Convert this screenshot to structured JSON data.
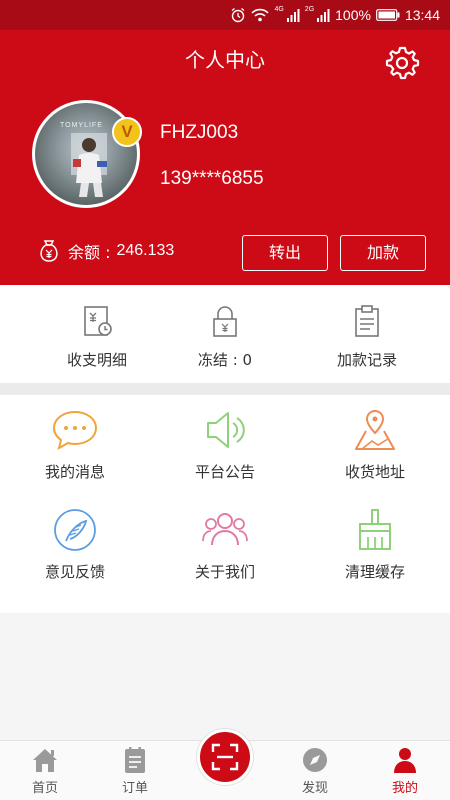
{
  "status_bar": {
    "network_4g": "4G",
    "network_2g": "2G",
    "battery": "100%",
    "time": "13:44"
  },
  "header": {
    "title": "个人中心",
    "avatar_text": "TOMYLIFE",
    "badge": "V",
    "username": "FHZJ003",
    "phone": "139****6855",
    "balance_label": "余额 : ",
    "balance_value": "246.133",
    "transfer_out": "转出",
    "add_funds": "加款"
  },
  "finance": {
    "items": [
      {
        "label": "收支明细",
        "icon": "receipt-clock-icon"
      },
      {
        "label": "冻结 : 0",
        "icon": "lock-icon"
      },
      {
        "label": "加款记录",
        "icon": "clipboard-icon"
      }
    ]
  },
  "grid": {
    "items": [
      {
        "label": "我的消息",
        "icon": "message-icon",
        "color": "#f0a43a"
      },
      {
        "label": "平台公告",
        "icon": "speaker-icon",
        "color": "#8fd17b"
      },
      {
        "label": "收货地址",
        "icon": "map-pin-icon",
        "color": "#f08b55"
      },
      {
        "label": "意见反馈",
        "icon": "feather-icon",
        "color": "#5b9de0"
      },
      {
        "label": "关于我们",
        "icon": "people-icon",
        "color": "#e17aa6"
      },
      {
        "label": "清理缓存",
        "icon": "broom-icon",
        "color": "#8fd17b"
      }
    ]
  },
  "bottom_nav": {
    "items": [
      {
        "label": "首页",
        "icon": "home-icon"
      },
      {
        "label": "订单",
        "icon": "order-icon"
      },
      {
        "label": "发现",
        "icon": "compass-icon"
      },
      {
        "label": "我的",
        "icon": "user-icon",
        "active": true
      }
    ],
    "center_icon": "scan-icon"
  },
  "colors": {
    "brand_red": "#cc0b16",
    "status_bar": "#a80a16"
  }
}
